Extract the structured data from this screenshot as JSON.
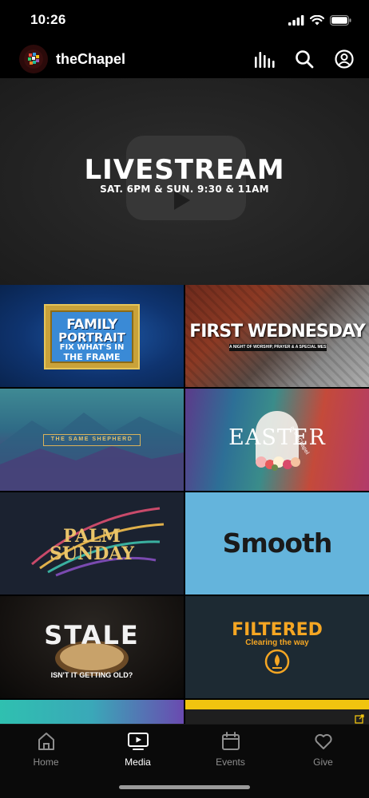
{
  "status": {
    "time": "10:26"
  },
  "header": {
    "title": "theChapel"
  },
  "hero": {
    "title": "LIVESTREAM",
    "subtitle": "SAT. 6PM & SUN. 9:30 & 11AM"
  },
  "tiles": [
    {
      "line1": "FAMILY",
      "line2": "PORTRAIT",
      "line3": "FIX WHAT'S IN",
      "line4": "THE FRAME"
    },
    {
      "title": "FIRST WEDNESDAY",
      "subtitle": "A NIGHT OF WORSHIP, PRAYER & A SPECIAL MESSAGE"
    },
    {
      "title": "THE SAME SHEPHERD"
    },
    {
      "title": "EASTER",
      "tag": "at theChapel"
    },
    {
      "line1": "PALM",
      "line2": "SUNDAY"
    },
    {
      "title": "Smooth"
    },
    {
      "title": "STALE",
      "subtitle": "ISN'T IT GETTING OLD?"
    },
    {
      "title": "FILTERED",
      "subtitle": "Clearing the way"
    },
    {
      "title": ""
    },
    {
      "title": ""
    }
  ],
  "tabs": [
    {
      "label": "Home",
      "icon": "home-icon"
    },
    {
      "label": "Media",
      "icon": "media-icon"
    },
    {
      "label": "Events",
      "icon": "calendar-icon"
    },
    {
      "label": "Give",
      "icon": "heart-icon"
    }
  ],
  "colors": {
    "accent_yellow": "#f1c40f",
    "filtered_orange": "#f5a623",
    "palm_gold": "#e9c46a"
  }
}
